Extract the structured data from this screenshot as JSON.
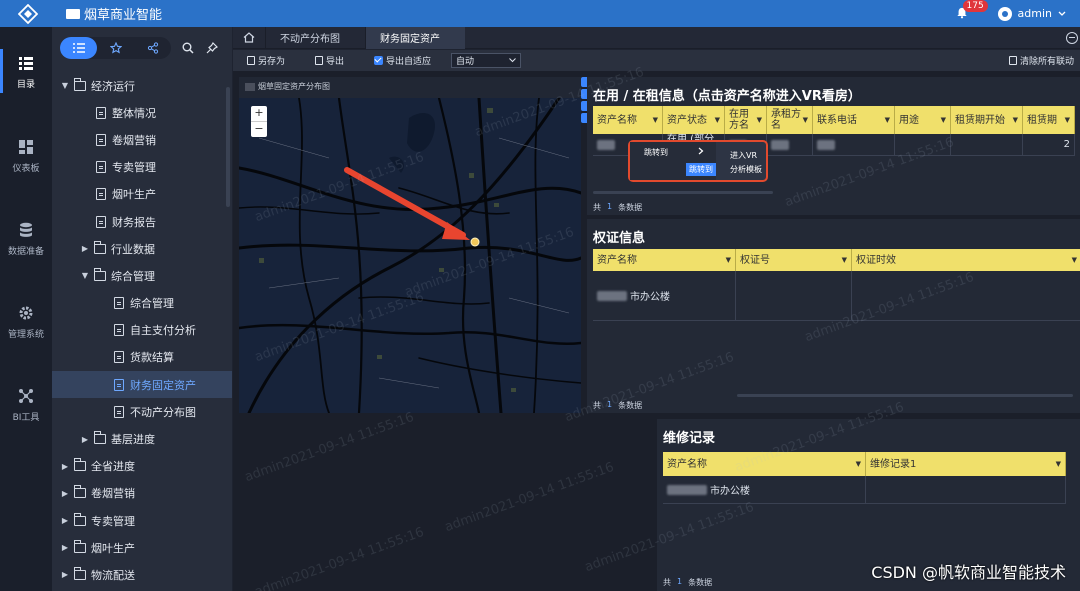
{
  "header": {
    "app_title": "烟草商业智能",
    "notification_count": "175",
    "user_name": "admin"
  },
  "rail": {
    "items": [
      {
        "label": "目录",
        "icon": "list-icon"
      },
      {
        "label": "仪表板",
        "icon": "dashboard-icon"
      },
      {
        "label": "数据准备",
        "icon": "database-icon"
      },
      {
        "label": "管理系统",
        "icon": "gear-icon"
      },
      {
        "label": "BI工具",
        "icon": "network-icon"
      }
    ]
  },
  "tree": {
    "items": [
      {
        "label": "经济运行",
        "level": 0,
        "type": "folder",
        "expanded": true
      },
      {
        "label": "整体情况",
        "level": 1,
        "type": "doc"
      },
      {
        "label": "卷烟营销",
        "level": 1,
        "type": "doc"
      },
      {
        "label": "专卖管理",
        "level": 1,
        "type": "doc"
      },
      {
        "label": "烟叶生产",
        "level": 1,
        "type": "doc"
      },
      {
        "label": "财务报告",
        "level": 1,
        "type": "doc"
      },
      {
        "label": "行业数据",
        "level": 1,
        "type": "folder",
        "expanded": false
      },
      {
        "label": "综合管理",
        "level": 1,
        "type": "folder",
        "expanded": true
      },
      {
        "label": "综合管理",
        "level": 2,
        "type": "doc"
      },
      {
        "label": "自主支付分析",
        "level": 2,
        "type": "doc"
      },
      {
        "label": "货款结算",
        "level": 2,
        "type": "doc"
      },
      {
        "label": "财务固定资产",
        "level": 2,
        "type": "doc",
        "selected": true
      },
      {
        "label": "不动产分布图",
        "level": 2,
        "type": "doc"
      },
      {
        "label": "基层进度",
        "level": 1,
        "type": "folder",
        "expanded": false
      },
      {
        "label": "全省进度",
        "level": 0,
        "type": "folder",
        "expanded": false
      },
      {
        "label": "卷烟营销",
        "level": 0,
        "type": "folder",
        "expanded": false
      },
      {
        "label": "专卖管理",
        "level": 0,
        "type": "folder",
        "expanded": false
      },
      {
        "label": "烟叶生产",
        "level": 0,
        "type": "folder",
        "expanded": false
      },
      {
        "label": "物流配送",
        "level": 0,
        "type": "folder",
        "expanded": false
      }
    ]
  },
  "tabs": [
    {
      "label": "不动产分布图",
      "active": false
    },
    {
      "label": "财务固定资产",
      "active": true
    }
  ],
  "toolbar": {
    "save_as": "另存为",
    "export": "导出",
    "checkbox_label": "导出自适应",
    "select_value": "自动",
    "clear": "清除所有联动"
  },
  "map_panel": {
    "title": "烟草固定资产分布图",
    "zoom_in": "+",
    "zoom_out": "−"
  },
  "in_use": {
    "title": "在用 / 在租信息（点击资产名称进入VR看房）",
    "columns": [
      "资产名称",
      "资产状态",
      "在用方名",
      "承租方名",
      "联系电话",
      "用途",
      "租赁期开始",
      "租赁期"
    ],
    "row_partial": "在用 (部分出",
    "row_tail": "2",
    "footer_prefix": "共",
    "footer_count": "1",
    "footer_suffix": "条数据"
  },
  "context_menu": {
    "jump_label": "跳转到",
    "jump_sub": "跳转到",
    "vr_label": "进入VR",
    "analysis_label": "分析模板"
  },
  "cert": {
    "title": "权证信息",
    "columns": [
      "资产名称",
      "权证号",
      "权证时效"
    ],
    "row_name": "市办公楼",
    "footer_prefix": "共",
    "footer_count": "1",
    "footer_suffix": "条数据"
  },
  "repair": {
    "title": "维修记录",
    "columns": [
      "资产名称",
      "维修记录1"
    ],
    "row_name": "市办公楼",
    "footer_prefix": "共",
    "footer_count": "1",
    "footer_suffix": "条数据"
  },
  "watermark_text": "admin2021-09-14 11:55:16",
  "credit": "CSDN @帆软商业智能技术",
  "colors": {
    "topbar": "#2b72c8",
    "accent": "#3b86ff",
    "grid_header": "#f0e06b",
    "callout": "#e24a2e"
  }
}
